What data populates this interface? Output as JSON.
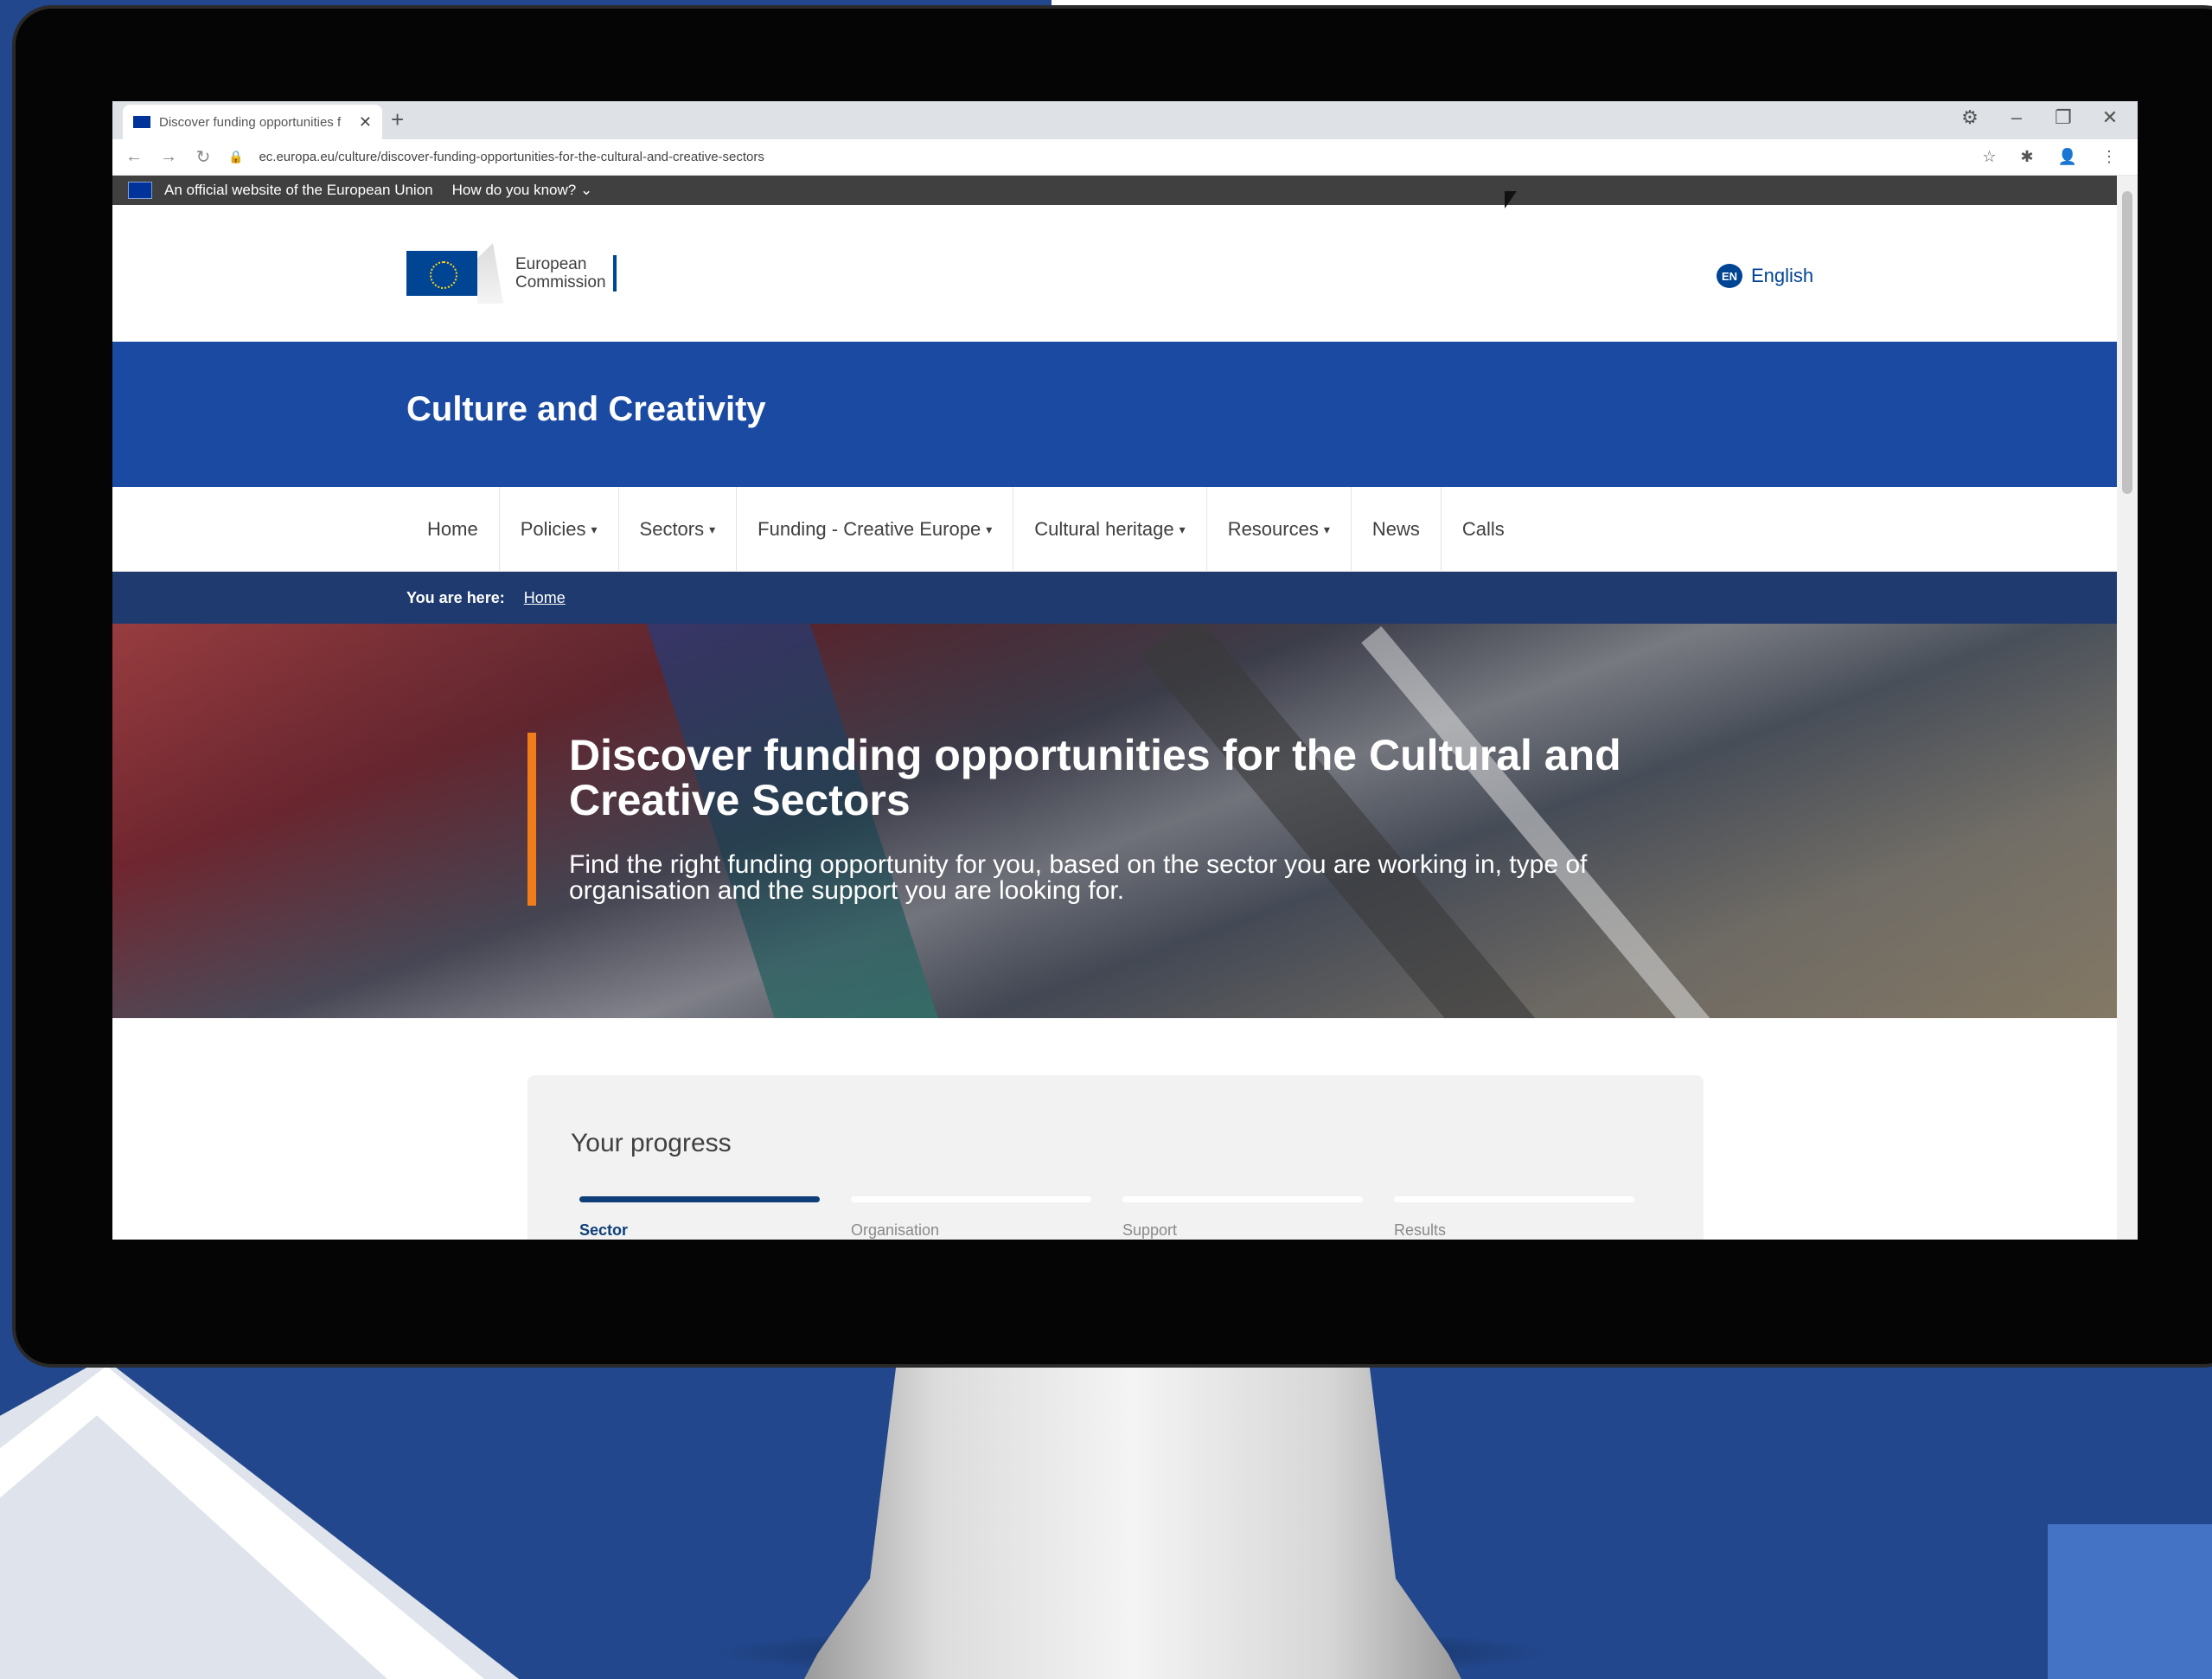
{
  "browser": {
    "tab_title": "Discover funding opportunities f",
    "tab_close": "✕",
    "tab_new": "+",
    "url": "ec.europa.eu/culture/discover-funding-opportunities-for-the-cultural-and-creative-sectors",
    "back": "←",
    "forward": "→",
    "reload": "↻",
    "lock": "🔒",
    "window_controls": {
      "settings": "⚙",
      "minimize": "–",
      "restore": "❐",
      "close": "✕"
    },
    "address_icons": {
      "star": "☆",
      "extensions": "✱",
      "profile": "👤",
      "menu": "⋮"
    }
  },
  "eu_strip": {
    "official_text": "An official website of the European Union",
    "how_link": "How do you know? ⌄"
  },
  "header": {
    "logo_line1": "European",
    "logo_line2": "Commission",
    "lang_code": "EN",
    "lang_label": "English"
  },
  "site": {
    "name": "Culture and Creativity"
  },
  "nav": {
    "items": [
      {
        "label": "Home",
        "caret": ""
      },
      {
        "label": "Policies",
        "caret": "▾"
      },
      {
        "label": "Sectors",
        "caret": "▾"
      },
      {
        "label": "Funding - Creative Europe",
        "caret": "▾"
      },
      {
        "label": "Cultural heritage",
        "caret": "▾"
      },
      {
        "label": "Resources",
        "caret": "▾"
      },
      {
        "label": "News",
        "caret": ""
      },
      {
        "label": "Calls",
        "caret": ""
      }
    ]
  },
  "breadcrumb": {
    "label": "You are here:",
    "home": "Home"
  },
  "hero": {
    "title": "Discover funding opportunities for the Cultural and Creative Sectors",
    "subtitle": "Find the right funding opportunity for you, based on the sector you are working in, type of organisation and the support you are looking for."
  },
  "progress": {
    "title": "Your progress",
    "steps": [
      {
        "label": "Sector",
        "active": true
      },
      {
        "label": "Organisation",
        "active": false
      },
      {
        "label": "Support",
        "active": false
      },
      {
        "label": "Results",
        "active": false
      }
    ]
  },
  "colors": {
    "eu_blue": "#004494",
    "banner_blue": "#1a4aa1",
    "breadcrumb_navy": "#1e3a6e",
    "accent_orange": "#f07c1a",
    "progress_active": "#0e3f78"
  }
}
